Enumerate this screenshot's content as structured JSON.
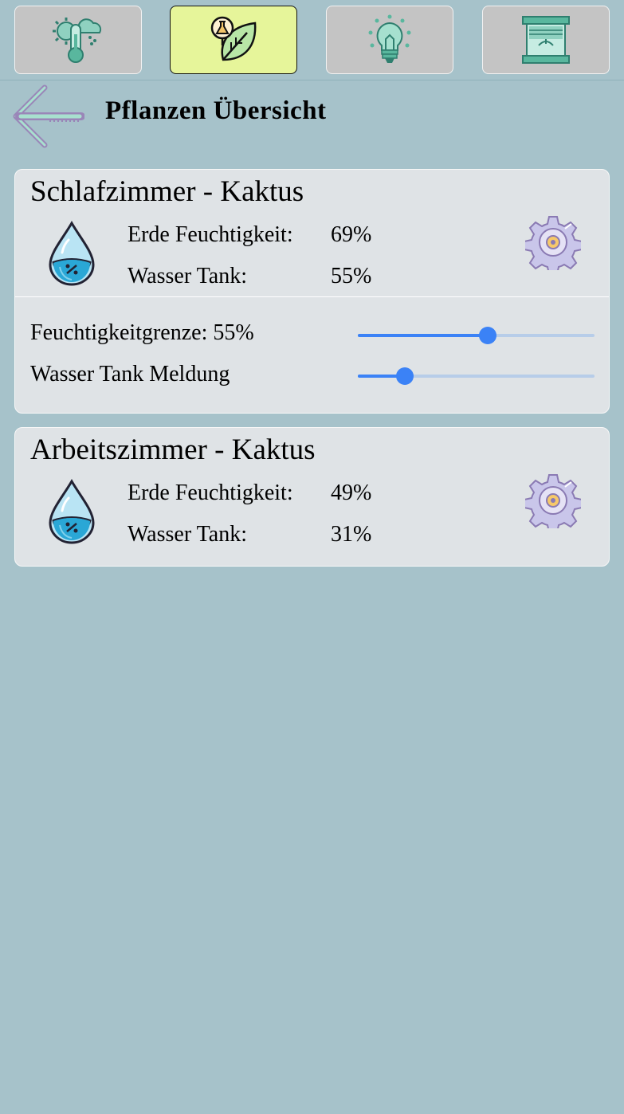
{
  "nav": {
    "items": [
      {
        "icon": "thermometer-weather-icon",
        "active": false
      },
      {
        "icon": "plant-leaf-icon",
        "active": true
      },
      {
        "icon": "light-bulb-icon",
        "active": false
      },
      {
        "icon": "window-blinds-icon",
        "active": false
      }
    ],
    "active_color": "#e6f59a",
    "inactive_color": "#c4c4c4"
  },
  "header": {
    "back_icon": "back-arrow-icon",
    "title": "Pflanzen Übersicht"
  },
  "plants": [
    {
      "title": "Schlafzimmer - Kaktus",
      "soil_label": "Erde Feuchtigkeit:",
      "soil_value": "69%",
      "tank_label": "Wasser Tank:",
      "tank_value": "55%",
      "settings_icon": "gear-icon",
      "expanded": true,
      "settings": {
        "threshold_label": "Feuchtigkeitgrenze: 55%",
        "threshold_value": 55,
        "tank_alert_label": "Wasser Tank Meldung",
        "tank_alert_value": 20
      }
    },
    {
      "title": "Arbeitszimmer - Kaktus",
      "soil_label": "Erde Feuchtigkeit:",
      "soil_value": "49%",
      "tank_label": "Wasser Tank:",
      "tank_value": "31%",
      "settings_icon": "gear-icon",
      "expanded": false
    }
  ],
  "colors": {
    "background": "#a6c2ca",
    "card": "#dfe3e6",
    "slider_accent": "#3b82f6",
    "slider_track": "#b7cde9"
  }
}
